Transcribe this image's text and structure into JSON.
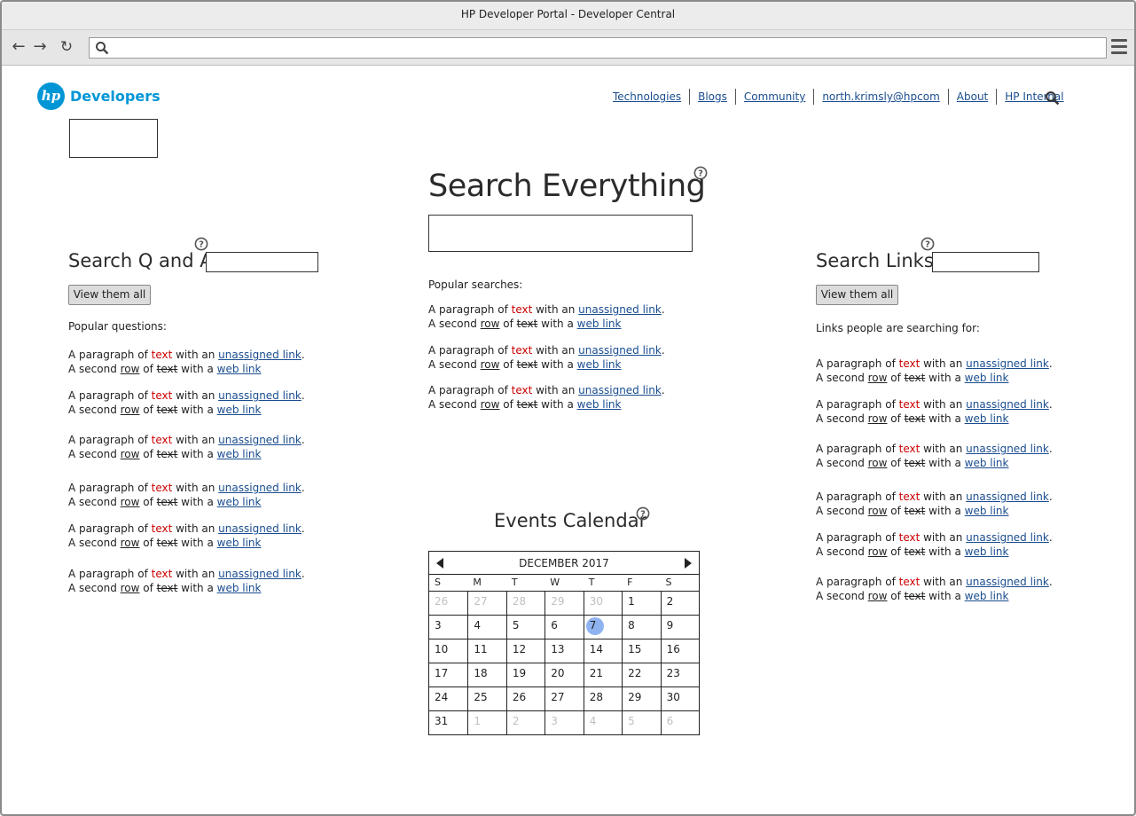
{
  "window": {
    "title": "HP Developer Portal - Developer Central"
  },
  "browser": {
    "address": ""
  },
  "header": {
    "logo_text": "hp",
    "brand": "Developers",
    "nav": [
      "Technologies",
      "Blogs",
      "Community",
      "north.krimsly@hpcom",
      "About",
      "HP Internal"
    ]
  },
  "main": {
    "title": "Search Everything",
    "popular_label": "Popular searches:",
    "paragraphs_count": 3
  },
  "left": {
    "title": "Search Q and A",
    "button": "View them all",
    "label": "Popular questions:"
  },
  "right": {
    "title": "Search Links",
    "button": "View them all",
    "label": "Links people are searching for:"
  },
  "para": {
    "a": "A paragraph of ",
    "red": "text",
    "b": " with an ",
    "link1": "unassigned link",
    "c": ".",
    "d": "A second ",
    "row": "row",
    "e": " of ",
    "strike": "text",
    "f": " with a ",
    "link2": "web link"
  },
  "calendar": {
    "title": "Events Calendar",
    "month": "DECEMBER 2017",
    "dow": [
      "S",
      "M",
      "T",
      "W",
      "T",
      "F",
      "S"
    ],
    "days": [
      [
        "26",
        "m"
      ],
      [
        "27",
        "m"
      ],
      [
        "28",
        "m"
      ],
      [
        "29",
        "m"
      ],
      [
        "30",
        "m"
      ],
      [
        "1",
        ""
      ],
      [
        "2",
        ""
      ],
      [
        "3",
        ""
      ],
      [
        "4",
        ""
      ],
      [
        "5",
        ""
      ],
      [
        "6",
        ""
      ],
      [
        "7",
        "t"
      ],
      [
        "8",
        ""
      ],
      [
        "9",
        ""
      ],
      [
        "10",
        ""
      ],
      [
        "11",
        ""
      ],
      [
        "12",
        ""
      ],
      [
        "13",
        ""
      ],
      [
        "14",
        ""
      ],
      [
        "15",
        ""
      ],
      [
        "16",
        ""
      ],
      [
        "17",
        ""
      ],
      [
        "18",
        ""
      ],
      [
        "19",
        ""
      ],
      [
        "20",
        ""
      ],
      [
        "21",
        ""
      ],
      [
        "22",
        ""
      ],
      [
        "23",
        ""
      ],
      [
        "24",
        ""
      ],
      [
        "25",
        ""
      ],
      [
        "26",
        ""
      ],
      [
        "27",
        ""
      ],
      [
        "28",
        ""
      ],
      [
        "29",
        ""
      ],
      [
        "30",
        ""
      ],
      [
        "31",
        ""
      ],
      [
        "1",
        "m"
      ],
      [
        "2",
        "m"
      ],
      [
        "3",
        "m"
      ],
      [
        "4",
        "m"
      ],
      [
        "5",
        "m"
      ],
      [
        "6",
        "m"
      ]
    ]
  },
  "colors": {
    "brand": "#0096d6",
    "link": "#1a4d8f",
    "red_text": "#cc0000",
    "today": "#8fb3f0"
  }
}
